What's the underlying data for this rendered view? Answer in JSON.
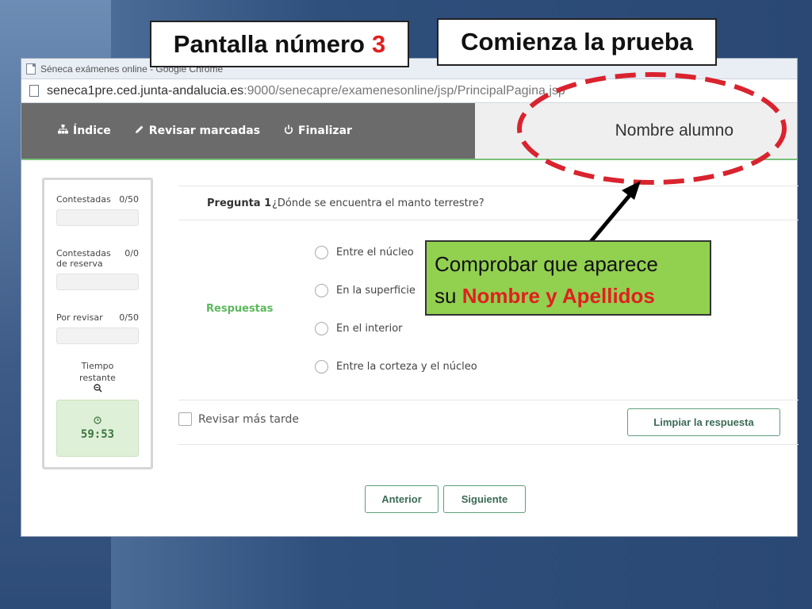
{
  "slide": {
    "screen_label": "Pantalla número",
    "screen_number": "3",
    "start_label": "Comienza la prueba",
    "note_line1": "Comprobar que aparece",
    "note_prefix": "su",
    "note_highlight": "Nombre y Apellidos",
    "colors": {
      "highlight": "#e0201f",
      "note_bg": "#92d050",
      "ellipse": "#d9232e"
    }
  },
  "browser": {
    "window_title": "Séneca exámenes online - Google Chrome",
    "url_host": "seneca1pre.ced.junta-andalucia.es",
    "url_rest": ":9000/senecapre/examenesonline/jsp/PrincipalPagina.jsp"
  },
  "nav": {
    "index": {
      "label": "Índice",
      "icon": "sitemap-icon"
    },
    "review_marked": {
      "label": "Revisar marcadas",
      "icon": "pencil-icon"
    },
    "finish": {
      "label": "Finalizar",
      "icon": "power-icon"
    },
    "student_name": "Nombre alumno"
  },
  "sidebar": {
    "answered": {
      "label": "Contestadas",
      "value": "0/50"
    },
    "reserve": {
      "label_line1": "Contestadas",
      "label_line2": "de reserva",
      "value": "0/0"
    },
    "to_review": {
      "label": "Por revisar",
      "value": "0/50"
    },
    "time_label_line1": "Tiempo",
    "time_label_line2": "restante",
    "time_value": "59:53",
    "colors": {
      "timer_bg": "#dff0d8",
      "timer_text": "#3c763d"
    }
  },
  "question": {
    "label": "Pregunta 1",
    "text": "¿Dónde se encuentra el manto terrestre?",
    "answers_label": "Respuestas",
    "options": [
      "Entre el núcleo",
      "En la superficie",
      "En el interior",
      "Entre la corteza y el núcleo"
    ],
    "review_later": "Revisar más tarde",
    "clear": "Limpiar la respuesta",
    "prev": "Anterior",
    "next": "Siguiente"
  }
}
